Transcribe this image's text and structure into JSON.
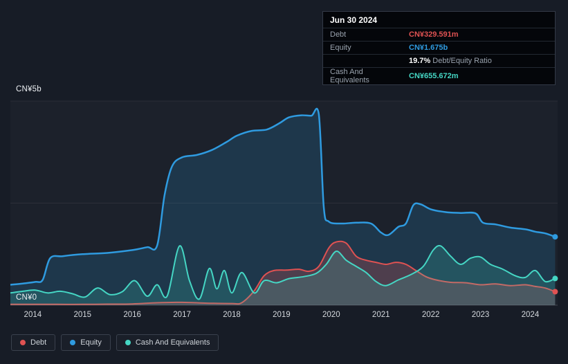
{
  "tooltip": {
    "date": "Jun 30 2024",
    "debt_label": "Debt",
    "debt_value": "CN¥329.591m",
    "equity_label": "Equity",
    "equity_value": "CN¥1.675b",
    "ratio_value": "19.7%",
    "ratio_label": "Debt/Equity Ratio",
    "cash_label": "Cash And Equivalents",
    "cash_value": "CN¥655.672m"
  },
  "chart_data": {
    "type": "area",
    "x_domain": [
      2013.55,
      2024.55
    ],
    "ylim": [
      0,
      5
    ],
    "y_gridlines": [
      0,
      2.5,
      5
    ],
    "y_axis": {
      "top_label": "CN¥5b",
      "bottom_label": "CN¥0"
    },
    "x_ticks": [
      "2014",
      "2015",
      "2016",
      "2017",
      "2018",
      "2019",
      "2020",
      "2021",
      "2022",
      "2023",
      "2024"
    ],
    "legend_position": "bottom-left",
    "draw_order": [
      1,
      0,
      2
    ],
    "series": [
      {
        "name": "Debt",
        "color": "#e05252",
        "fill": "rgba(224,82,82,0.25)",
        "points": [
          [
            2013.55,
            0.02
          ],
          [
            2014.0,
            0.02
          ],
          [
            2014.5,
            0.02
          ],
          [
            2015.0,
            0.02
          ],
          [
            2015.5,
            0.025
          ],
          [
            2016.0,
            0.03
          ],
          [
            2016.5,
            0.06
          ],
          [
            2017.0,
            0.07
          ],
          [
            2017.5,
            0.05
          ],
          [
            2018.0,
            0.04
          ],
          [
            2018.2,
            0.06
          ],
          [
            2018.45,
            0.35
          ],
          [
            2018.65,
            0.72
          ],
          [
            2018.85,
            0.85
          ],
          [
            2019.1,
            0.86
          ],
          [
            2019.35,
            0.88
          ],
          [
            2019.55,
            0.83
          ],
          [
            2019.75,
            0.95
          ],
          [
            2019.95,
            1.4
          ],
          [
            2020.1,
            1.55
          ],
          [
            2020.3,
            1.52
          ],
          [
            2020.5,
            1.2
          ],
          [
            2020.7,
            1.1
          ],
          [
            2020.9,
            1.05
          ],
          [
            2021.1,
            1.0
          ],
          [
            2021.3,
            1.05
          ],
          [
            2021.5,
            1.0
          ],
          [
            2021.7,
            0.85
          ],
          [
            2021.9,
            0.7
          ],
          [
            2022.1,
            0.62
          ],
          [
            2022.4,
            0.56
          ],
          [
            2022.7,
            0.55
          ],
          [
            2023.0,
            0.5
          ],
          [
            2023.3,
            0.52
          ],
          [
            2023.6,
            0.48
          ],
          [
            2023.9,
            0.5
          ],
          [
            2024.1,
            0.46
          ],
          [
            2024.3,
            0.42
          ],
          [
            2024.5,
            0.33
          ]
        ]
      },
      {
        "name": "Equity",
        "color": "#2f9be0",
        "fill": "rgba(47,155,224,0.18)",
        "points": [
          [
            2013.55,
            0.5
          ],
          [
            2013.8,
            0.53
          ],
          [
            2014.05,
            0.57
          ],
          [
            2014.2,
            0.62
          ],
          [
            2014.35,
            1.15
          ],
          [
            2014.6,
            1.2
          ],
          [
            2015.0,
            1.25
          ],
          [
            2015.5,
            1.28
          ],
          [
            2016.0,
            1.35
          ],
          [
            2016.3,
            1.42
          ],
          [
            2016.5,
            1.46
          ],
          [
            2016.65,
            2.7
          ],
          [
            2016.8,
            3.4
          ],
          [
            2017.0,
            3.62
          ],
          [
            2017.3,
            3.68
          ],
          [
            2017.6,
            3.8
          ],
          [
            2017.9,
            4.0
          ],
          [
            2018.1,
            4.15
          ],
          [
            2018.4,
            4.27
          ],
          [
            2018.7,
            4.3
          ],
          [
            2018.95,
            4.45
          ],
          [
            2019.15,
            4.6
          ],
          [
            2019.4,
            4.65
          ],
          [
            2019.6,
            4.64
          ],
          [
            2019.75,
            4.68
          ],
          [
            2019.85,
            2.4
          ],
          [
            2019.95,
            2.05
          ],
          [
            2020.2,
            2.0
          ],
          [
            2020.5,
            2.02
          ],
          [
            2020.8,
            2.0
          ],
          [
            2021.0,
            1.78
          ],
          [
            2021.15,
            1.72
          ],
          [
            2021.35,
            1.92
          ],
          [
            2021.5,
            2.0
          ],
          [
            2021.65,
            2.45
          ],
          [
            2021.8,
            2.47
          ],
          [
            2022.0,
            2.35
          ],
          [
            2022.3,
            2.28
          ],
          [
            2022.6,
            2.26
          ],
          [
            2022.9,
            2.25
          ],
          [
            2023.05,
            2.02
          ],
          [
            2023.3,
            1.98
          ],
          [
            2023.6,
            1.9
          ],
          [
            2023.9,
            1.86
          ],
          [
            2024.1,
            1.8
          ],
          [
            2024.3,
            1.76
          ],
          [
            2024.5,
            1.675
          ]
        ]
      },
      {
        "name": "Cash And Equivalents",
        "color": "#45d6c4",
        "fill": "rgba(69,214,196,0.18)",
        "points": [
          [
            2013.55,
            0.3
          ],
          [
            2013.8,
            0.34
          ],
          [
            2014.05,
            0.37
          ],
          [
            2014.3,
            0.3
          ],
          [
            2014.55,
            0.34
          ],
          [
            2014.8,
            0.28
          ],
          [
            2015.05,
            0.2
          ],
          [
            2015.3,
            0.42
          ],
          [
            2015.55,
            0.26
          ],
          [
            2015.8,
            0.33
          ],
          [
            2016.05,
            0.6
          ],
          [
            2016.3,
            0.22
          ],
          [
            2016.5,
            0.5
          ],
          [
            2016.7,
            0.22
          ],
          [
            2016.95,
            1.45
          ],
          [
            2017.15,
            0.6
          ],
          [
            2017.35,
            0.15
          ],
          [
            2017.55,
            0.9
          ],
          [
            2017.7,
            0.4
          ],
          [
            2017.85,
            0.85
          ],
          [
            2018.0,
            0.3
          ],
          [
            2018.2,
            0.8
          ],
          [
            2018.45,
            0.3
          ],
          [
            2018.65,
            0.6
          ],
          [
            2018.9,
            0.55
          ],
          [
            2019.15,
            0.65
          ],
          [
            2019.45,
            0.7
          ],
          [
            2019.7,
            0.78
          ],
          [
            2019.9,
            1.0
          ],
          [
            2020.1,
            1.32
          ],
          [
            2020.3,
            1.1
          ],
          [
            2020.5,
            0.95
          ],
          [
            2020.7,
            0.8
          ],
          [
            2020.9,
            0.58
          ],
          [
            2021.1,
            0.48
          ],
          [
            2021.35,
            0.62
          ],
          [
            2021.6,
            0.75
          ],
          [
            2021.85,
            0.95
          ],
          [
            2022.05,
            1.35
          ],
          [
            2022.2,
            1.45
          ],
          [
            2022.4,
            1.2
          ],
          [
            2022.6,
            1.0
          ],
          [
            2022.8,
            1.15
          ],
          [
            2023.0,
            1.18
          ],
          [
            2023.2,
            1.0
          ],
          [
            2023.45,
            0.88
          ],
          [
            2023.7,
            0.72
          ],
          [
            2023.9,
            0.68
          ],
          [
            2024.1,
            0.85
          ],
          [
            2024.3,
            0.58
          ],
          [
            2024.5,
            0.655
          ]
        ]
      }
    ]
  }
}
